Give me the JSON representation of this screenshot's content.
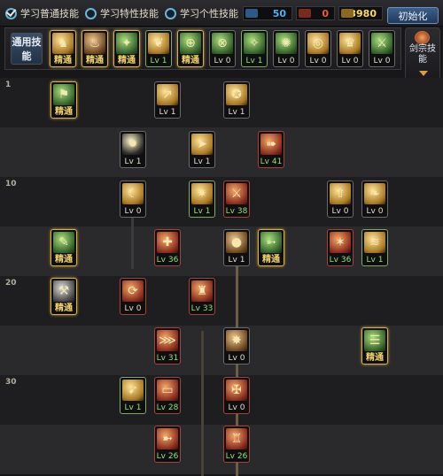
{
  "tabs": [
    {
      "label": "学习普通技能",
      "checked": true
    },
    {
      "label": "学习特性技能",
      "checked": false
    },
    {
      "label": "学习个性技能",
      "checked": false
    }
  ],
  "points": [
    {
      "value": "50",
      "color": "#4fb0f0"
    },
    {
      "value": "0",
      "color": "#e85a3a"
    },
    {
      "value": "3980",
      "color": "#ffd860"
    }
  ],
  "init_button": "初始化",
  "common": {
    "label": "通用技能",
    "skills": [
      "精通",
      "精通",
      "精通",
      "Lv 1",
      "精通",
      "Lv 0",
      "Lv 1",
      "Lv 0",
      "Lv 0",
      "Lv 0",
      "Lv 0"
    ]
  },
  "right_panel": {
    "label": "剑宗技能"
  },
  "levels": [
    "1",
    "10",
    "20",
    "30"
  ],
  "skills": {
    "r1_mastered": "精通",
    "r1_a": "Lv 1",
    "r1_b": "Lv 1",
    "r2_a": "Lv 1",
    "r2_b": "Lv 1",
    "r2_c": "Lv 41",
    "r3_a": "Lv 0",
    "r3_b": "Lv 1",
    "r3_c": "Lv 38",
    "r3_d": "Lv 0",
    "r3_e": "Lv 0",
    "r4_mastered": "精通",
    "r4_a": "Lv 36",
    "r4_b": "Lv 1",
    "r4_c": "精通",
    "r4_d": "Lv 36",
    "r4_e": "Lv 1",
    "r5_mastered": "精通",
    "r5_a": "Lv 0",
    "r5_b": "Lv 33",
    "r6_a": "Lv 31",
    "r6_b": "Lv 0",
    "r6_c": "精通",
    "r7_a": "Lv 1",
    "r7_b": "Lv 28",
    "r7_c": "Lv 0",
    "r8_a": "Lv 26",
    "r8_b": "Lv 26"
  }
}
